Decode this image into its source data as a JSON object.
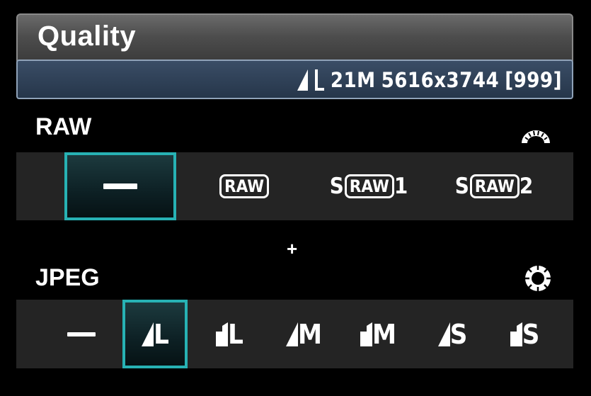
{
  "header": {
    "title": "Quality"
  },
  "status": {
    "size_code": "21M",
    "resolution": "5616x3744",
    "shots": "[999]"
  },
  "raw": {
    "label": "RAW",
    "dial_icon": "main-dial-icon",
    "options": [
      {
        "key": "none",
        "badge": "",
        "suffix": "",
        "prefix": "",
        "selected": true
      },
      {
        "key": "raw",
        "prefix": "",
        "badge": "RAW",
        "suffix": "",
        "selected": false
      },
      {
        "key": "sraw1",
        "prefix": "S",
        "badge": "RAW",
        "suffix": "1",
        "selected": false
      },
      {
        "key": "sraw2",
        "prefix": "S",
        "badge": "RAW",
        "suffix": "2",
        "selected": false
      }
    ]
  },
  "plus_sign": "+",
  "jpeg": {
    "label": "JPEG",
    "dial_icon": "quick-control-dial-icon",
    "options": [
      {
        "key": "none",
        "letter": "",
        "quality": "none",
        "selected": false
      },
      {
        "key": "large-fine",
        "letter": "L",
        "quality": "fine",
        "selected": true
      },
      {
        "key": "large-normal",
        "letter": "L",
        "quality": "normal",
        "selected": false
      },
      {
        "key": "medium-fine",
        "letter": "M",
        "quality": "fine",
        "selected": false
      },
      {
        "key": "medium-normal",
        "letter": "M",
        "quality": "normal",
        "selected": false
      },
      {
        "key": "small-fine",
        "letter": "S",
        "quality": "fine",
        "selected": false
      },
      {
        "key": "small-normal",
        "letter": "S",
        "quality": "normal",
        "selected": false
      }
    ]
  },
  "colors": {
    "selection": "#27b2b4",
    "info_bar": "#2e4058",
    "strip": "#242424"
  }
}
